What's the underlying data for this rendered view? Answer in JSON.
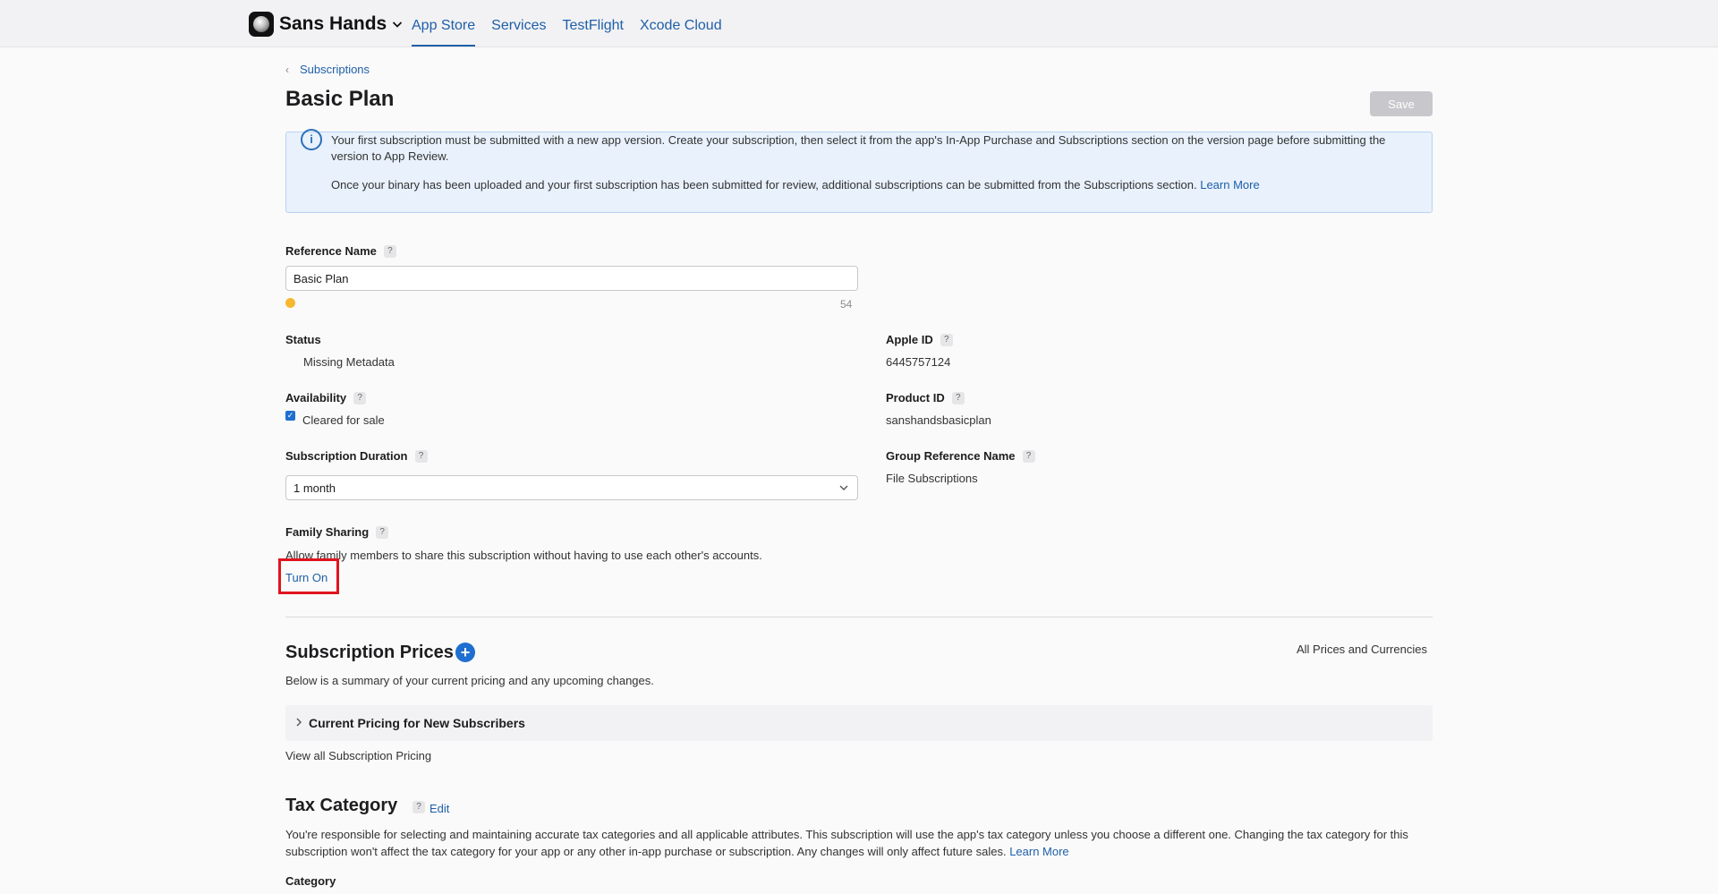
{
  "header": {
    "app_name": "Sans Hands",
    "nav": [
      {
        "label": "App Store",
        "active": true
      },
      {
        "label": "Services"
      },
      {
        "label": "TestFlight"
      },
      {
        "label": "Xcode Cloud"
      }
    ]
  },
  "breadcrumb": {
    "label": "Subscriptions"
  },
  "page": {
    "title": "Basic Plan",
    "save_label": "Save"
  },
  "info": {
    "p1": "Your first subscription must be submitted with a new app version. Create your subscription, then select it from the app's In-App Purchase and Subscriptions section on the version page before submitting the version to App Review.",
    "p2": "Once your binary has been uploaded and your first subscription has been submitted for review, additional subscriptions can be submitted from the Subscriptions section.",
    "learn_more": "Learn More"
  },
  "form": {
    "reference_name": {
      "label": "Reference Name",
      "value": "Basic Plan",
      "counter": "54"
    },
    "status": {
      "label": "Status",
      "value": "Missing Metadata"
    },
    "availability": {
      "label": "Availability",
      "value": "Cleared for sale"
    },
    "duration": {
      "label": "Subscription Duration",
      "value": "1 month"
    },
    "family_sharing": {
      "label": "Family Sharing",
      "description": "Allow family members to share this subscription without having to use each other's accounts.",
      "action": "Turn On"
    },
    "apple_id": {
      "label": "Apple ID",
      "value": "6445757124"
    },
    "product_id": {
      "label": "Product ID",
      "value": "sanshandsbasicplan"
    },
    "group_reference": {
      "label": "Group Reference Name",
      "value": "File Subscriptions"
    }
  },
  "prices": {
    "title": "Subscription Prices",
    "all_link": "All Prices and Currencies",
    "summary": "Below is a summary of your current pricing and any upcoming changes.",
    "current_pricing": "Current Pricing for New Subscribers",
    "view_all": "View all Subscription Pricing"
  },
  "tax": {
    "title": "Tax Category",
    "edit": "Edit",
    "text": "You're responsible for selecting and maintaining accurate tax categories and all applicable attributes. This subscription will use the app's tax category unless you choose a different one. Changing the tax category for this subscription won't affect the tax category for your app or any other in-app purchase or subscription. Any changes will only affect future sales.",
    "learn_more": "Learn More",
    "category_label": "Category"
  },
  "help_glyph": "?",
  "colors": {
    "link": "#1f5fa8",
    "accent": "#1f6fd0",
    "status_warning": "#f5b82e",
    "highlight": "#e0141f"
  }
}
